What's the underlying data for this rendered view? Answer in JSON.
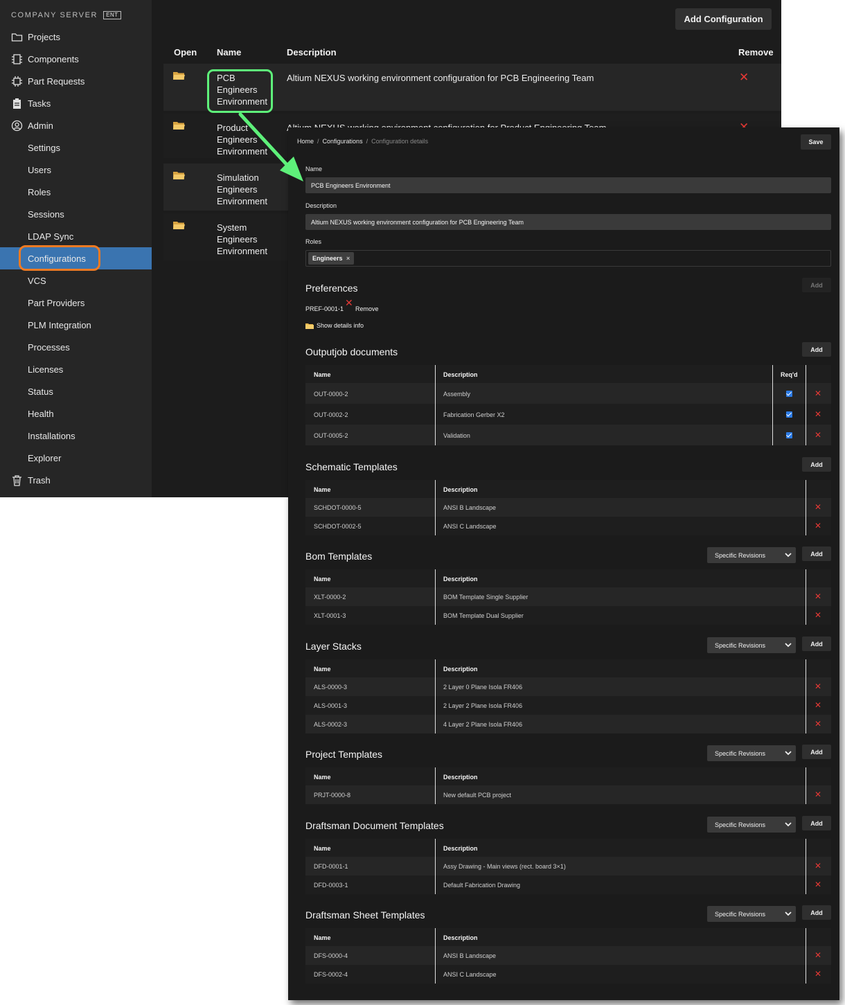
{
  "sidebar": {
    "brand": "COMPANY SERVER",
    "badge": "ENT",
    "items": [
      {
        "label": "Projects",
        "icon": "folder-outline-icon"
      },
      {
        "label": "Components",
        "icon": "chip-icon"
      },
      {
        "label": "Part Requests",
        "icon": "part-request-icon"
      },
      {
        "label": "Tasks",
        "icon": "clipboard-icon"
      },
      {
        "label": "Admin",
        "icon": "user-circle-icon"
      },
      {
        "label": "Settings"
      },
      {
        "label": "Users"
      },
      {
        "label": "Roles"
      },
      {
        "label": "Sessions"
      },
      {
        "label": "LDAP Sync"
      },
      {
        "label": "Configurations",
        "active": true
      },
      {
        "label": "VCS"
      },
      {
        "label": "Part Providers"
      },
      {
        "label": "PLM Integration"
      },
      {
        "label": "Processes"
      },
      {
        "label": "Licenses"
      },
      {
        "label": "Status"
      },
      {
        "label": "Health"
      },
      {
        "label": "Installations"
      },
      {
        "label": "Explorer"
      },
      {
        "label": "Trash",
        "icon": "trash-icon"
      }
    ]
  },
  "main": {
    "add_button": "Add Configuration",
    "columns": {
      "open": "Open",
      "name": "Name",
      "description": "Description",
      "remove": "Remove"
    },
    "rows": [
      {
        "name": [
          "PCB",
          "Engineers",
          "Environment"
        ],
        "description": "Altium NEXUS working environment configuration for PCB Engineering Team"
      },
      {
        "name": [
          "Product",
          "Engineers",
          "Environment"
        ],
        "description": "Altium NEXUS working environment configuration for Product Engineering Team"
      },
      {
        "name": [
          "Simulation",
          "Engineers",
          "Environment"
        ],
        "description": ""
      },
      {
        "name": [
          "System",
          "Engineers",
          "Environment"
        ],
        "description": ""
      }
    ]
  },
  "details": {
    "breadcrumb": {
      "home": "Home",
      "sep": "/",
      "configurations": "Configurations",
      "current": "Configuration details"
    },
    "save": "Save",
    "name_label": "Name",
    "name_value": "PCB Engineers Environment",
    "description_label": "Description",
    "description_value": "Altium NEXUS working environment configuration for PCB Engineering Team",
    "roles_label": "Roles",
    "role_chip": "Engineers",
    "role_chip_remove": "×",
    "preferences": {
      "title": "Preferences",
      "add": "Add",
      "item": "PREF-0001-1",
      "remove": "Remove",
      "show_details": "Show details info"
    },
    "add_label": "Add",
    "select_value": "Specific Revisions",
    "col_name": "Name",
    "col_description": "Description",
    "col_reqd": "Req'd",
    "outputjob": {
      "title": "Outputjob documents",
      "rows": [
        {
          "name": "OUT-0000-2",
          "desc": "Assembly",
          "reqd": true
        },
        {
          "name": "OUT-0002-2",
          "desc": "Fabrication Gerber X2",
          "reqd": true
        },
        {
          "name": "OUT-0005-2",
          "desc": "Validation",
          "reqd": true
        }
      ]
    },
    "schematic": {
      "title": "Schematic Templates",
      "rows": [
        {
          "name": "SCHDOT-0000-5",
          "desc": "ANSI B Landscape"
        },
        {
          "name": "SCHDOT-0002-5",
          "desc": "ANSI C Landscape"
        }
      ]
    },
    "bom": {
      "title": "Bom Templates",
      "rows": [
        {
          "name": "XLT-0000-2",
          "desc": "BOM Template Single Supplier"
        },
        {
          "name": "XLT-0001-3",
          "desc": "BOM Template Dual Supplier"
        }
      ]
    },
    "layer": {
      "title": "Layer Stacks",
      "rows": [
        {
          "name": "ALS-0000-3",
          "desc": "2 Layer 0 Plane Isola FR406"
        },
        {
          "name": "ALS-0001-3",
          "desc": "2 Layer 2 Plane Isola FR406"
        },
        {
          "name": "ALS-0002-3",
          "desc": "4 Layer 2 Plane Isola FR406"
        }
      ]
    },
    "project": {
      "title": "Project Templates",
      "rows": [
        {
          "name": "PRJT-0000-8",
          "desc": "New default PCB project"
        }
      ]
    },
    "draftdoc": {
      "title": "Draftsman Document Templates",
      "rows": [
        {
          "name": "DFD-0001-1",
          "desc": "Assy Drawing - Main views (rect. board 3×1)"
        },
        {
          "name": "DFD-0003-1",
          "desc": "Default Fabrication Drawing"
        }
      ]
    },
    "draftsheet": {
      "title": "Draftsman Sheet Templates",
      "rows": [
        {
          "name": "DFS-0000-4",
          "desc": "ANSI B Landscape"
        },
        {
          "name": "DFS-0002-4",
          "desc": "ANSI C Landscape"
        }
      ]
    }
  },
  "colors": {
    "accent": "#3a74b0",
    "highlight_orange": "#f07a22",
    "highlight_green": "#5ef07a",
    "remove_red": "#e53935",
    "checkbox_blue": "#2c7be5"
  }
}
